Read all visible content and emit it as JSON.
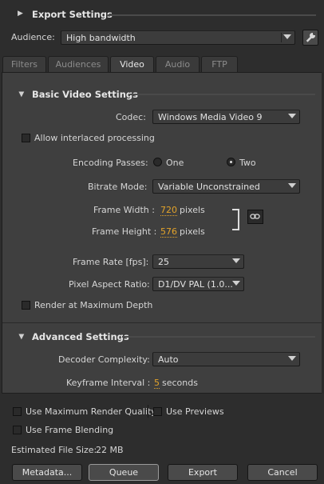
{
  "export_settings": {
    "title": "Export Settings"
  },
  "audience": {
    "label": "Audience:",
    "value": "High bandwidth"
  },
  "tabs": [
    {
      "label": "Filters",
      "active": false
    },
    {
      "label": "Audiences",
      "active": false
    },
    {
      "label": "Video",
      "active": true
    },
    {
      "label": "Audio",
      "active": false
    },
    {
      "label": "FTP",
      "active": false
    }
  ],
  "basic": {
    "title": "Basic Video Settings",
    "codec_label": "Codec:",
    "codec_value": "Windows Media Video 9",
    "interlaced_label": "Allow interlaced processing",
    "passes_label": "Encoding Passes:",
    "passes_one": "One",
    "passes_two": "Two",
    "bitrate_label": "Bitrate Mode:",
    "bitrate_value": "Variable Unconstrained",
    "width_label": "Frame Width :",
    "width_value": "720",
    "width_unit": "pixels",
    "height_label": "Frame Height :",
    "height_value": "576",
    "height_unit": "pixels",
    "framerate_label": "Frame Rate [fps]:",
    "framerate_value": "25",
    "par_label": "Pixel Aspect Ratio:",
    "par_value": "D1/DV PAL (1.0...",
    "max_depth_label": "Render at Maximum Depth"
  },
  "advanced": {
    "title": "Advanced Settings",
    "decoder_label": "Decoder Complexity:",
    "decoder_value": "Auto",
    "keyframe_label": "Keyframe Interval :",
    "keyframe_value": "5",
    "keyframe_unit": "seconds"
  },
  "footer": {
    "max_quality_label": "Use Maximum Render Quality",
    "previews_label": "Use Previews",
    "frame_blending_label": "Use Frame Blending",
    "file_size_label": "Estimated File Size:",
    "file_size_value": "22 MB",
    "metadata_btn": "Metadata...",
    "queue_btn": "Queue",
    "export_btn": "Export",
    "cancel_btn": "Cancel"
  },
  "icons": {
    "wrench": "wrench-icon",
    "link": "link-icon"
  }
}
